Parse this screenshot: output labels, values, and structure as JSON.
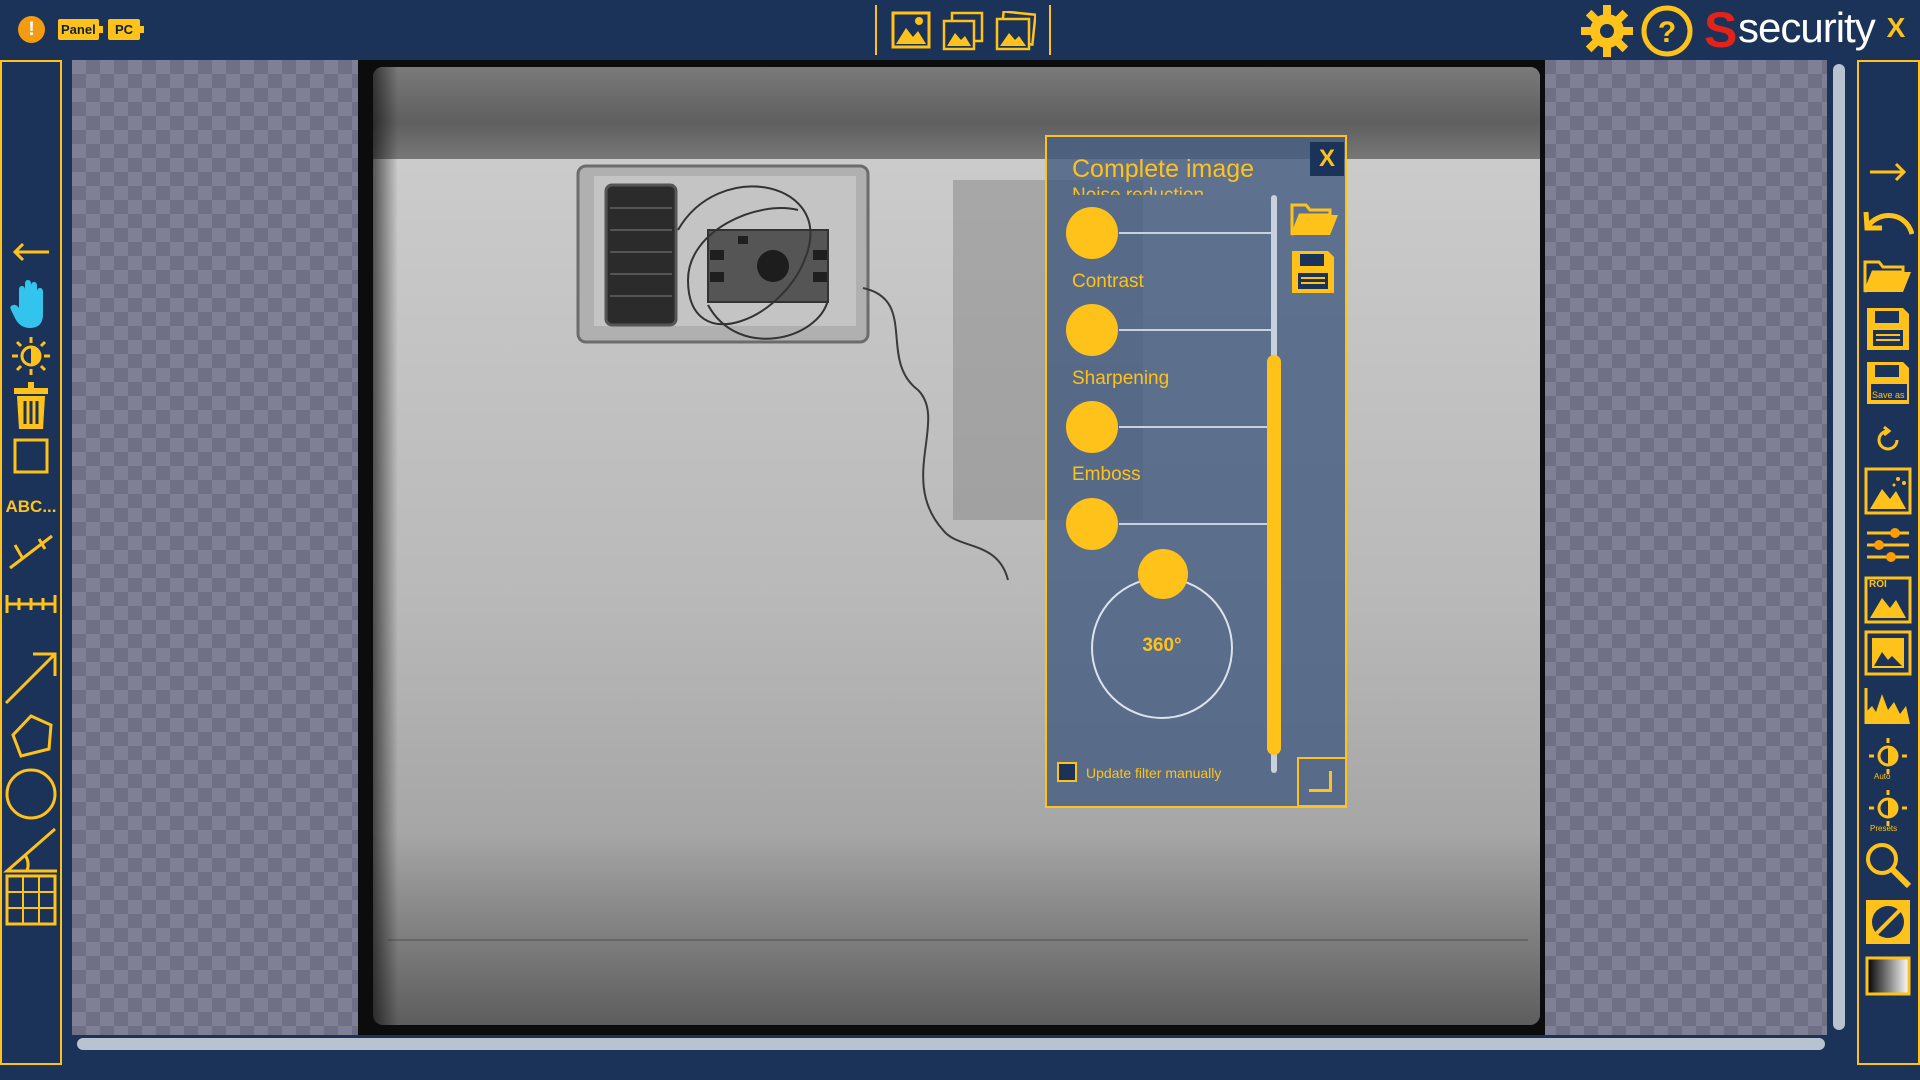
{
  "topbar": {
    "warning_icon": "warning-icon",
    "warning_glyph": "!",
    "source_panel_label": "Panel",
    "source_pc_label": "PC",
    "modes": [
      "single-image-icon",
      "multi-image-icon",
      "compare-image-icon"
    ],
    "settings_icon": "gear-icon",
    "help_icon": "help-icon",
    "brand_letter": "S",
    "brand_text": "security",
    "close_label": "X"
  },
  "left_toolbar": {
    "tools": [
      "back-arrow-icon",
      "hand-pan-icon",
      "brightness-icon",
      "delete-trash-icon",
      "rectangle-icon",
      "text-annotation-tool",
      "line-tool-icon",
      "ruler-icon",
      "arrow-tool-icon",
      "polygon-tool-icon",
      "ellipse-tool-icon",
      "angle-tool-icon",
      "grid-tool-icon"
    ],
    "text_tool_label": "ABC..."
  },
  "right_toolbar": {
    "tools": [
      "forward-arrow-icon",
      "undo-arrow-icon",
      "open-folder-icon",
      "save-icon",
      "save-as-icon",
      "reset-icon",
      "image-filter-icon",
      "adjust-sliders-icon",
      "roi-filter-icon",
      "image-frame-icon",
      "histogram-icon",
      "auto-brightness-icon",
      "presets-brightness-icon",
      "zoom-icon",
      "invert-icon",
      "gradient-icon"
    ],
    "save_as_label": "Save as",
    "roi_label": "ROI",
    "auto_label": "Auto",
    "presets_label": "Presets"
  },
  "filter_panel": {
    "title": "Complete image",
    "close_label": "X",
    "hidden_label": "Noise reduction",
    "sliders": [
      {
        "label": "Noise reduction",
        "value": 0
      },
      {
        "label": "Contrast",
        "value": 0
      },
      {
        "label": "Sharpening",
        "value": 0
      },
      {
        "label": "Emboss",
        "value": 0
      }
    ],
    "rotation_label": "360°",
    "manual_update_label": "Update filter manually",
    "manual_update_checked": false
  },
  "colors": {
    "accent": "#ffc21a",
    "background": "#1b3358",
    "brand_red": "#e2231a"
  }
}
